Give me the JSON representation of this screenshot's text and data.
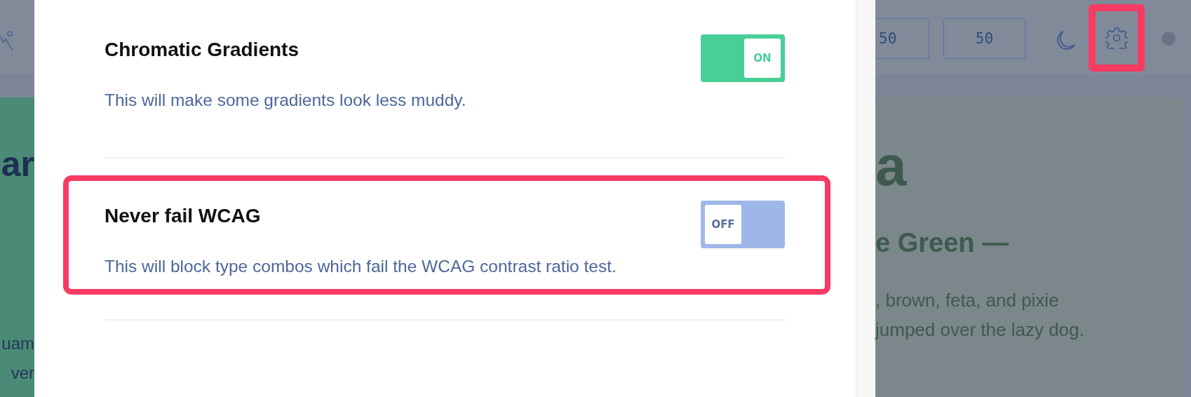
{
  "toolbar": {
    "fields": [
      {
        "value": "50"
      },
      {
        "value": "50"
      }
    ],
    "settings_button": {
      "highlighted": true
    }
  },
  "left_card": {
    "heading": "ar",
    "text_lines": [
      "uam",
      "ver"
    ]
  },
  "right_card": {
    "heading": "a",
    "subheading": "e Green —",
    "text_lines": [
      ", brown, feta, and pixie",
      "jumped over the lazy dog."
    ]
  },
  "settings": [
    {
      "title": "Chromatic Gradients",
      "description": "This will make some gradients look less muddy.",
      "on": true,
      "toggle_label": "ON",
      "highlighted": false
    },
    {
      "title": "Never fail WCAG",
      "description": "This will block type combos which fail the WCAG contrast ratio test.",
      "on": false,
      "toggle_label": "OFF",
      "highlighted": true
    }
  ]
}
